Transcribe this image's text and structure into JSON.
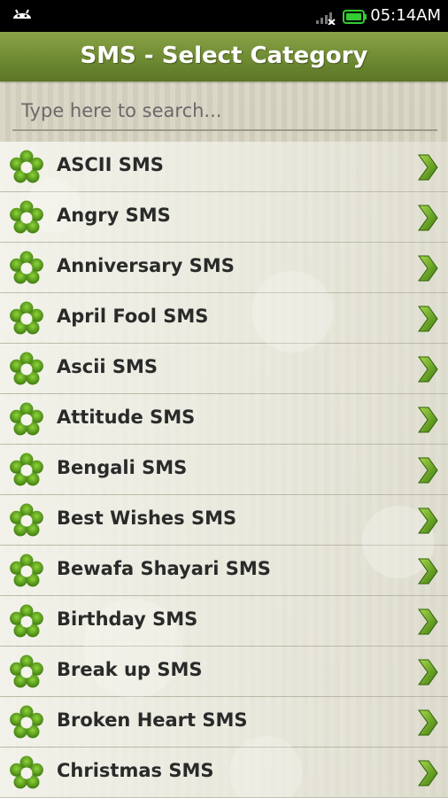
{
  "status_bar": {
    "time": "05:14AM",
    "icons": [
      "android-icon",
      "signal-icon",
      "battery-icon"
    ]
  },
  "header": {
    "title": "SMS - Select Category"
  },
  "search": {
    "placeholder": "Type here to search..."
  },
  "categories": [
    "ASCII SMS",
    "Angry SMS",
    "Anniversary SMS",
    "April Fool SMS",
    "Ascii SMS",
    "Attitude SMS",
    "Bengali SMS",
    "Best Wishes SMS",
    "Bewafa Shayari SMS",
    "Birthday SMS",
    "Break up SMS",
    "Broken Heart SMS",
    "Christmas SMS"
  ],
  "colors": {
    "header_green": "#6e8a32",
    "icon_green": "#5a9a1a",
    "battery_green": "#33cc33"
  }
}
